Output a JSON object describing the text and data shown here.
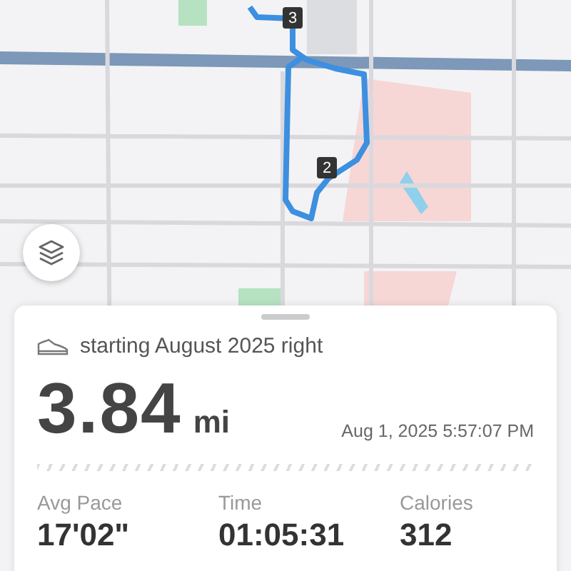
{
  "map": {
    "kind": "picture",
    "markers": [
      {
        "label": "3"
      },
      {
        "label": "2"
      }
    ]
  },
  "activity": {
    "title": "starting August 2025 right",
    "distance": "3.84",
    "unit": "mi",
    "datetime": "Aug 1, 2025 5:57:07 PM"
  },
  "stats": [
    {
      "label": "Avg Pace",
      "value": "17'02\""
    },
    {
      "label": "Time",
      "value": "01:05:31"
    },
    {
      "label": "Calories",
      "value": "312"
    }
  ]
}
